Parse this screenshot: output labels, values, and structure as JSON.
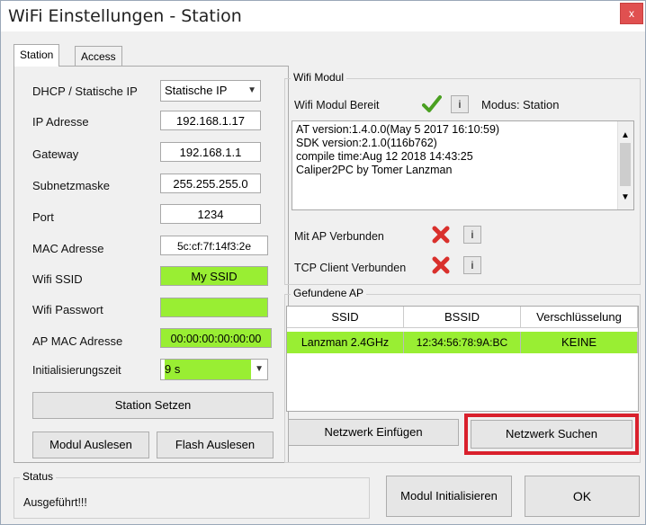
{
  "window": {
    "title": "WiFi Einstellungen - Station",
    "close_glyph": "x"
  },
  "tabs": [
    "Station",
    "Access Point"
  ],
  "station": {
    "dhcp_label": "DHCP / Statische IP",
    "dhcp_value": "Statische IP",
    "ip_label": "IP Adresse",
    "ip_value": "192.168.1.17",
    "gateway_label": "Gateway",
    "gateway_value": "192.168.1.1",
    "subnet_label": "Subnetzmaske",
    "subnet_value": "255.255.255.0",
    "port_label": "Port",
    "port_value": "1234",
    "mac_label": "MAC Adresse",
    "mac_value": "5c:cf:7f:14f3:2e",
    "ssid_label": "Wifi SSID",
    "ssid_value": "My SSID",
    "pass_label": "Wifi Passwort",
    "pass_value": "",
    "apmac_label": "AP MAC Adresse",
    "apmac_value": "00:00:00:00:00:00",
    "init_label": "Initialisierungszeit",
    "init_value": "9 s",
    "set_button": "Station Setzen",
    "read_button": "Modul Auslesen",
    "flash_button": "Flash Auslesen"
  },
  "wifi_module": {
    "group_title": "Wifi Modul",
    "ready_label": "Wifi Modul Bereit",
    "info": "i",
    "mode_label": "Modus:",
    "mode_value": "Station",
    "log_lines": [
      "AT version:1.4.0.0(May  5 2017 16:10:59)",
      "SDK version:2.1.0(116b762)",
      "compile time:Aug 12 2018 14:43:25",
      "Caliper2PC by Tomer Lanzman"
    ],
    "ap_connected_label": "Mit AP Verbunden",
    "tcp_connected_label": "TCP Client Verbunden"
  },
  "found_ap": {
    "group_title": "Gefundene AP",
    "columns": [
      "SSID",
      "BSSID",
      "Verschlüsselung"
    ],
    "rows": [
      {
        "ssid": "Lanzman 2.4GHz",
        "bssid": "12:34:56:78:9A:BC",
        "enc": "KEINE"
      }
    ],
    "insert_button": "Netzwerk Einfügen",
    "search_button": "Netzwerk Suchen"
  },
  "status": {
    "group_title": "Status",
    "text": "Ausgeführt!!!"
  },
  "footer": {
    "init_button": "Modul Initialisieren",
    "ok_button": "OK"
  },
  "colors": {
    "highlight_green": "#99ee33",
    "highlight_red": "#d9202c",
    "check_green": "#4aa021",
    "x_red": "#d9302c"
  }
}
